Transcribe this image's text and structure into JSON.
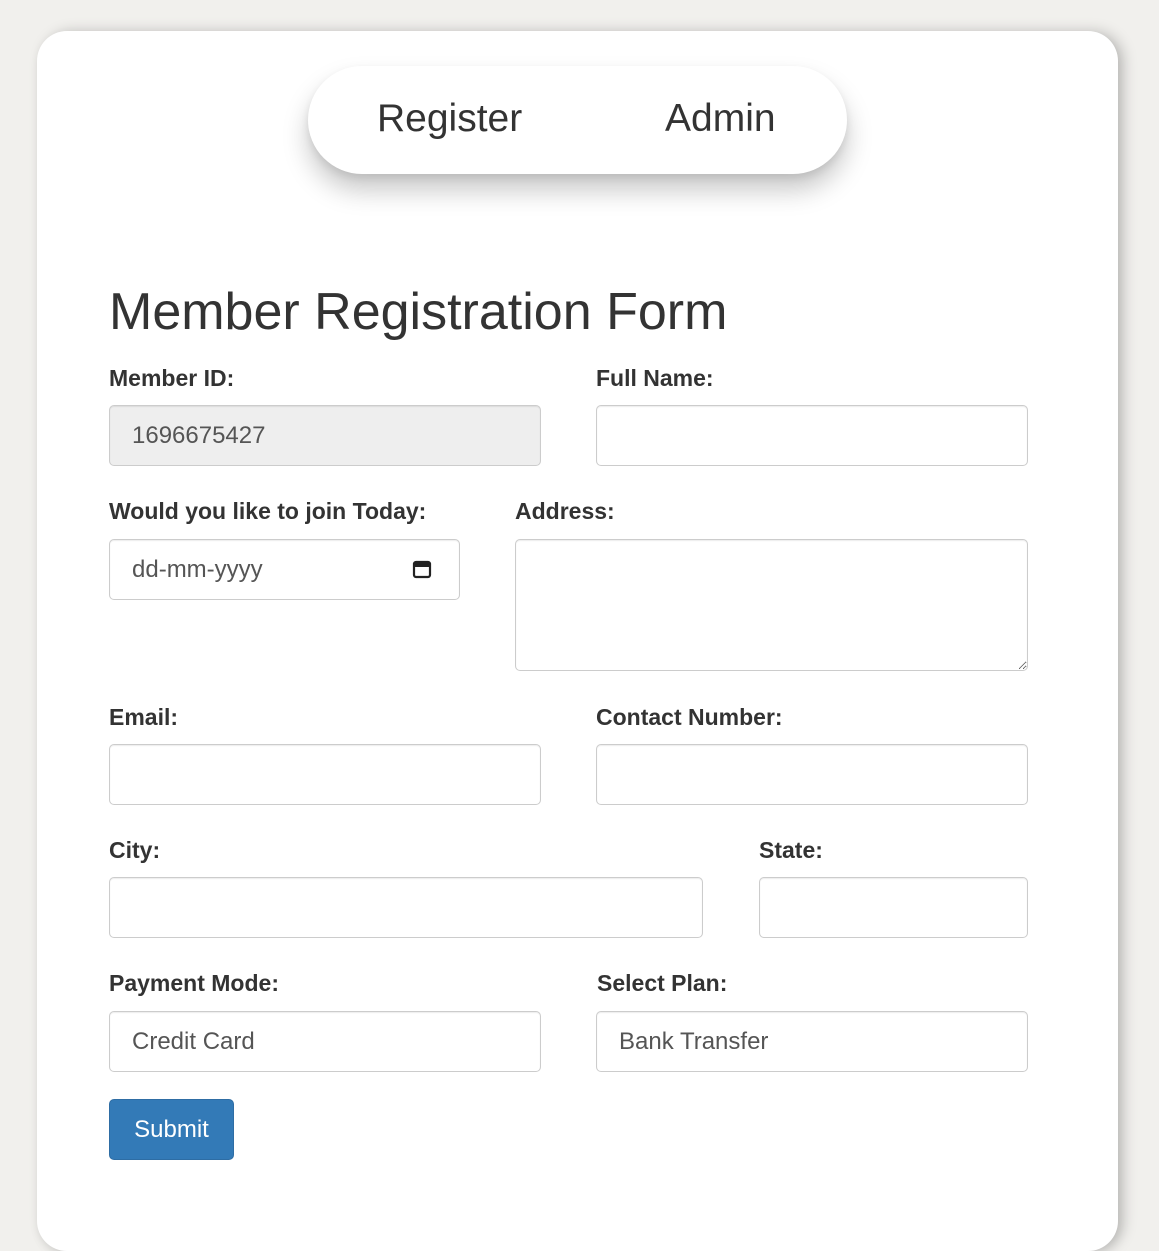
{
  "nav": {
    "register_label": "Register",
    "admin_label": "Admin"
  },
  "form": {
    "title": "Member Registration Form",
    "member_id": {
      "label": "Member ID:",
      "value": "1696675427"
    },
    "full_name": {
      "label": "Full Name:",
      "value": ""
    },
    "join_date": {
      "label": "Would you like to join Today:",
      "placeholder": "dd-mm-yyyy",
      "icon": "calendar-icon"
    },
    "address": {
      "label": "Address:",
      "value": ""
    },
    "email": {
      "label": "Email:",
      "value": ""
    },
    "contact_number": {
      "label": "Contact Number:",
      "value": ""
    },
    "city": {
      "label": "City:",
      "value": ""
    },
    "state": {
      "label": "State:",
      "value": ""
    },
    "payment_mode": {
      "label": "Payment Mode:",
      "placeholder": "Credit Card"
    },
    "select_plan": {
      "label": "Select Plan:",
      "placeholder": "Bank Transfer"
    },
    "submit_label": "Submit"
  },
  "colors": {
    "page_background": "#f1f0ed",
    "card_background": "#ffffff",
    "text": "#333333",
    "input_text": "#555555",
    "input_border": "#cccccc",
    "readonly_background": "#eeeeee",
    "primary_button": "#337ab7"
  }
}
